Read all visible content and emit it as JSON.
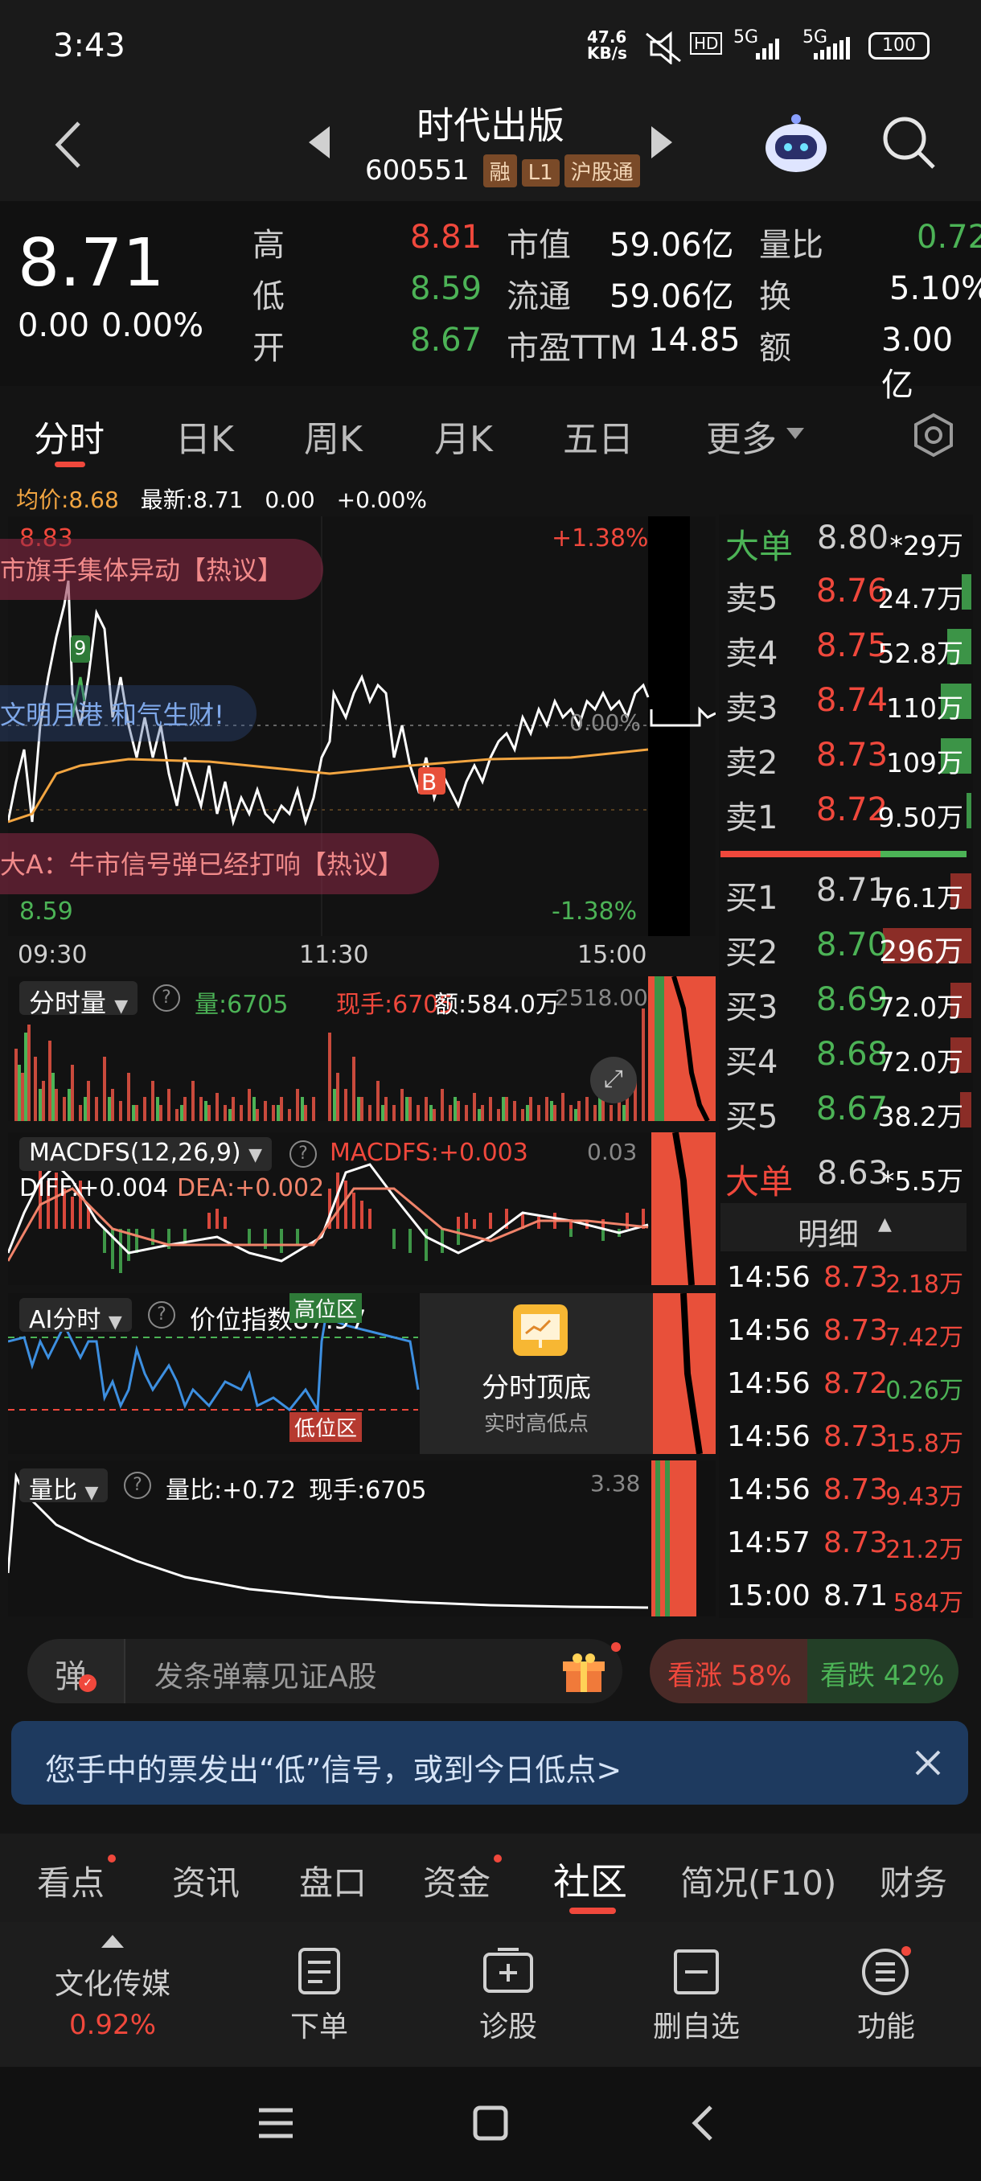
{
  "status": {
    "time": "3:43",
    "net_speed": "47.6 KB/s",
    "battery": "100",
    "net_a": "HD",
    "net_b": "5G",
    "net_c": "5G"
  },
  "header": {
    "title": "时代出版",
    "code": "600551",
    "tags": [
      "融",
      "L1",
      "沪股通"
    ]
  },
  "quote": {
    "price": "8.71",
    "change": "0.00",
    "change_pct": "0.00%",
    "high_label": "高",
    "high": "8.81",
    "low_label": "低",
    "low": "8.59",
    "open_label": "开",
    "open": "8.67",
    "mkt_cap_label": "市值",
    "mkt_cap": "59.06亿",
    "float_label": "流通",
    "float": "59.06亿",
    "pe_label": "市盈TTM",
    "pe": "14.85",
    "vol_ratio_label": "量比",
    "vol_ratio": "0.72",
    "turnover_label": "换",
    "turnover": "5.10%",
    "amount_label": "额",
    "amount": "3.00亿"
  },
  "chart_tabs": [
    "分时",
    "日K",
    "周K",
    "月K",
    "五日",
    "更多"
  ],
  "minute": {
    "avg_label": "均价:8.68",
    "latest_label": "最新:8.71",
    "chg": "0.00",
    "chg_pct": "+0.00%",
    "top_price": "8.83",
    "top_pct": "+1.38%",
    "bottom_price": "8.59",
    "bottom_pct": "-1.38%",
    "mid_pct": "0.00%",
    "times": [
      "09:30",
      "11:30",
      "15:00"
    ],
    "banners": [
      "市旗手集体异动【热议】",
      "文明月港 和气生财!",
      "大A：牛市信号弹已经打响【热议】"
    ],
    "b_marker": "B",
    "nine": "9"
  },
  "volume_panel": {
    "label": "分时量",
    "vol": "量:6705",
    "now": "现手:6705",
    "amt": "额:584.0万",
    "max": "2518.00"
  },
  "macd_panel": {
    "label": "MACDFS(12,26,9)",
    "val": "MACDFS:+0.003",
    "diff": "DIFF:+0.004",
    "dea": "DEA:+0.002",
    "max": "0.03"
  },
  "ai_panel": {
    "label": "AI分时",
    "index": "价位指数87.97",
    "high_zone": "高位区",
    "low_zone": "低位区",
    "card_title": "分时顶底",
    "card_sub": "实时高低点"
  },
  "ratio_panel": {
    "label": "量比",
    "val": "量比:+0.72",
    "now": "现手:6705",
    "max": "3.38"
  },
  "orderbook": {
    "big_sell": {
      "label": "大单",
      "price": "8.80",
      "vol": "*29万"
    },
    "asks": [
      {
        "label": "卖5",
        "price": "8.76",
        "vol": "24.7万"
      },
      {
        "label": "卖4",
        "price": "8.75",
        "vol": "52.8万"
      },
      {
        "label": "卖3",
        "price": "8.74",
        "vol": "110万"
      },
      {
        "label": "卖2",
        "price": "8.73",
        "vol": "109万"
      },
      {
        "label": "卖1",
        "price": "8.72",
        "vol": "9.50万"
      }
    ],
    "bids": [
      {
        "label": "买1",
        "price": "8.71",
        "vol": "76.1万"
      },
      {
        "label": "买2",
        "price": "8.70",
        "vol": "296万"
      },
      {
        "label": "买3",
        "price": "8.69",
        "vol": "72.0万"
      },
      {
        "label": "买4",
        "price": "8.68",
        "vol": "72.0万"
      },
      {
        "label": "买5",
        "price": "8.67",
        "vol": "38.2万"
      }
    ],
    "big_buy": {
      "label": "大单",
      "price": "8.63",
      "vol": "*5.5万"
    }
  },
  "details": {
    "title": "明细",
    "rows": [
      {
        "t": "14:56",
        "p": "8.73",
        "v": "2.18万"
      },
      {
        "t": "14:56",
        "p": "8.73",
        "v": "7.42万"
      },
      {
        "t": "14:56",
        "p": "8.72",
        "v": "0.26万"
      },
      {
        "t": "14:56",
        "p": "8.73",
        "v": "15.8万"
      },
      {
        "t": "14:56",
        "p": "8.73",
        "v": "9.43万"
      },
      {
        "t": "14:57",
        "p": "8.73",
        "v": "21.2万"
      },
      {
        "t": "15:00",
        "p": "8.71",
        "v": "584万"
      }
    ]
  },
  "comment_bar": {
    "icon": "弹",
    "placeholder": "发条弹幕见证A股",
    "up": "看涨 58%",
    "down": "看跌 42%"
  },
  "alert": {
    "text": "您手中的票发出“低”信号，或到今日低点>"
  },
  "info_tabs": [
    "看点",
    "资讯",
    "盘口",
    "资金",
    "社区",
    "简况(F10)",
    "财务"
  ],
  "bottom_bar": {
    "sector": "文化传媒",
    "sector_pct": "0.92%",
    "items": [
      "下单",
      "诊股",
      "删自选",
      "功能"
    ]
  },
  "colors": {
    "up": "#f0483c",
    "down": "#4cb356",
    "avg": "#f2a541",
    "bg": "#141414"
  }
}
